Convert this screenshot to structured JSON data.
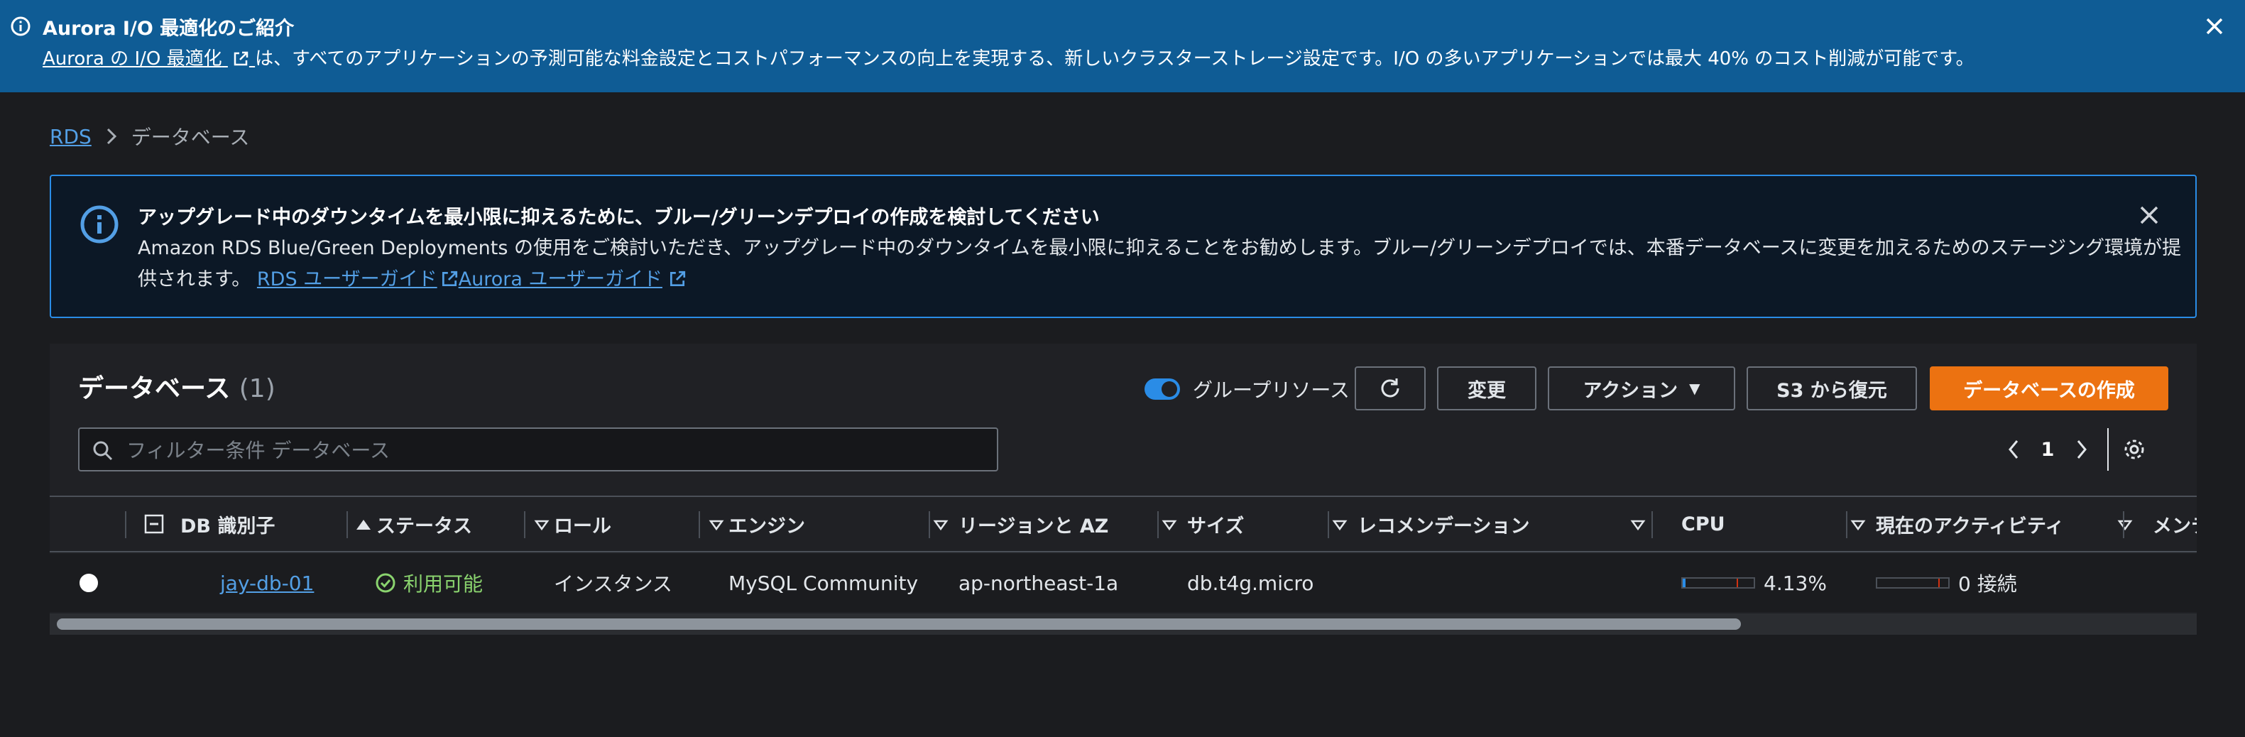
{
  "banner": {
    "title": "Aurora I/O 最適化のご紹介",
    "link": "Aurora の I/O 最適化",
    "message": " は、すべてのアプリケーションの予測可能な料金設定とコストパフォーマンスの向上を実現する、新しいクラスターストレージ設定です。I/O の多いアプリケーションでは最大 40% のコスト削減が可能です。"
  },
  "breadcrumb": {
    "root": "RDS",
    "current": "データベース"
  },
  "alert": {
    "title": "アップグレード中のダウンタイムを最小限に抑えるために、ブルー/グリーンデプロイの作成を検討してください",
    "body": "Amazon RDS Blue/Green Deployments の使用をご検討いただき、アップグレード中のダウンタイムを最小限に抑えることをお勧めします。ブルー/グリーンデプロイでは、本番データベースに変更を加えるためのステージング環境が提供されます。",
    "link1": "RDS ユーザーガイド",
    "link2": "Aurora ユーザーガイド"
  },
  "panel": {
    "title": "データベース",
    "count": "(1)",
    "group_toggle": "グループリソース",
    "group_toggle_on": true,
    "modify": "変更",
    "actions": "アクション",
    "restore_s3": "S3 から復元",
    "create": "データベースの作成",
    "search_placeholder": "フィルター条件 データベース",
    "page": "1"
  },
  "table": {
    "headers": [
      "DB 識別子",
      "ステータス",
      "ロール",
      "エンジン",
      "リージョンと AZ",
      "サイズ",
      "レコメンデーション",
      "CPU",
      "現在のアクティビティ",
      "メンテ"
    ],
    "rows": [
      {
        "id": "jay-db-01",
        "status": "利用可能",
        "role": "インスタンス",
        "engine": "MySQL Community",
        "region": "ap-northeast-1a",
        "size": "db.t4g.micro",
        "recommendation": "",
        "cpu": "4.13%",
        "cpu_fraction": 0.0413,
        "activity": "0 接続",
        "activity_fraction": 0
      }
    ]
  },
  "colors": {
    "primary": "#ec7211",
    "link": "#539fe5",
    "success": "#8ad36e",
    "info": "#2a8ce6",
    "banner": "#0f5c95"
  }
}
